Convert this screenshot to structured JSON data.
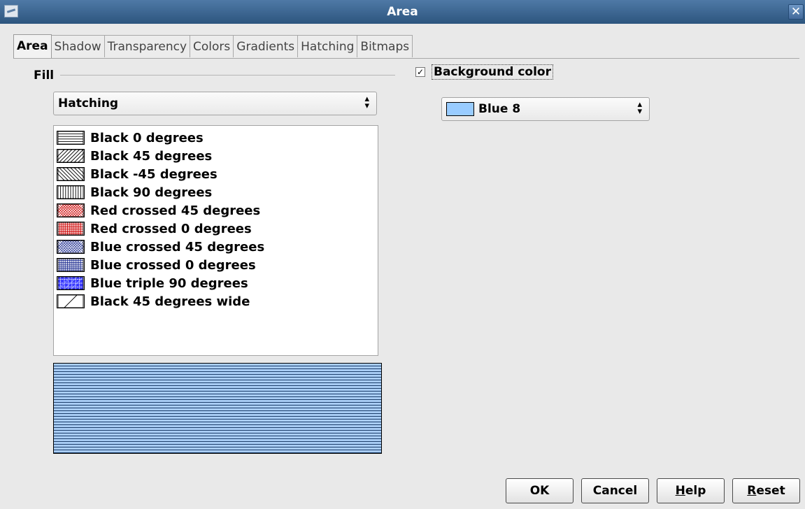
{
  "window": {
    "title": "Area",
    "close_glyph": "✕"
  },
  "tabs": [
    {
      "label": "Area",
      "active": true
    },
    {
      "label": "Shadow"
    },
    {
      "label": "Transparency"
    },
    {
      "label": "Colors"
    },
    {
      "label": "Gradients"
    },
    {
      "label": "Hatching"
    },
    {
      "label": "Bitmaps"
    }
  ],
  "fill": {
    "label": "Fill",
    "selected": "Hatching",
    "hatch_list": [
      {
        "label": "Black 0 degrees",
        "icon": "hatch-black-0-icon",
        "color": "#000000"
      },
      {
        "label": "Black 45 degrees",
        "icon": "hatch-black-45-icon",
        "color": "#000000"
      },
      {
        "label": "Black -45 degrees",
        "icon": "hatch-black-minus45-icon",
        "color": "#000000"
      },
      {
        "label": "Black 90 degrees",
        "icon": "hatch-black-90-icon",
        "color": "#000000"
      },
      {
        "label": "Red crossed 45 degrees",
        "icon": "hatch-red-crossed-45-icon",
        "color": "#cc0000"
      },
      {
        "label": "Red crossed 0 degrees",
        "icon": "hatch-red-crossed-0-icon",
        "color": "#cc0000"
      },
      {
        "label": "Blue crossed 45 degrees",
        "icon": "hatch-blue-crossed-45-icon",
        "color": "#1b2a8f"
      },
      {
        "label": "Blue crossed 0 degrees",
        "icon": "hatch-blue-crossed-0-icon",
        "color": "#1b2a8f"
      },
      {
        "label": "Blue triple 90 degrees",
        "icon": "hatch-blue-triple-90-icon",
        "color": "#0000ff"
      },
      {
        "label": "Black 45 degrees wide",
        "icon": "hatch-black-45-wide-icon",
        "color": "#000000"
      }
    ]
  },
  "background": {
    "checkbox_label": "Background color",
    "checked": true,
    "color_name": "Blue 8",
    "color_hex": "#99ccff"
  },
  "preview": {
    "line_color": "#1d3f6b",
    "background_color": "#a9cdf5"
  },
  "buttons": {
    "ok": "OK",
    "cancel": "Cancel",
    "help_mnemonic": "H",
    "help_rest": "elp",
    "reset_mnemonic": "R",
    "reset_rest": "eset"
  }
}
